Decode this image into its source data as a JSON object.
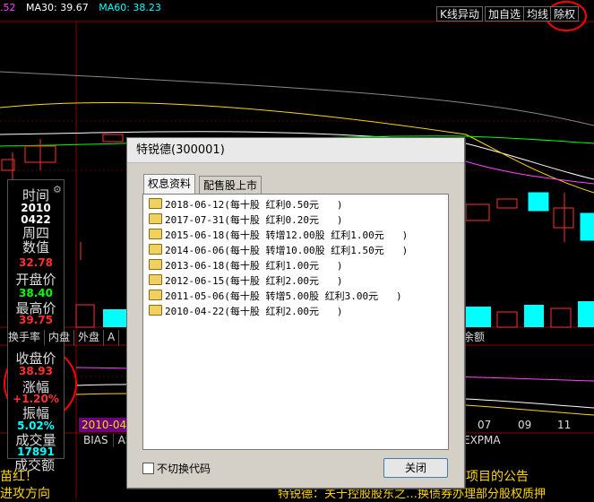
{
  "ma_bar": {
    "ma_first": ".52",
    "ma30": "MA30: 39.67",
    "ma60": "MA60: 38.23"
  },
  "toolbar": {
    "kline": "K线异动",
    "add_fav": "加自选",
    "avg": "均线",
    "exright": "除权"
  },
  "info_panel": {
    "time_label": "时间",
    "year": "2010",
    "date": "0422",
    "weekday": "周四",
    "value_label": "数值",
    "value": "32.78",
    "open_label": "开盘价",
    "open": "38.40",
    "high_label": "最高价",
    "high": "39.75",
    "close_label": "收盘价",
    "close": "38.93",
    "change_label": "涨幅",
    "change": "+1.20%",
    "amp_label": "振幅",
    "amp": "5.02%",
    "vol_label": "成交量",
    "vol": "17891",
    "amt_label": "成交额"
  },
  "bottom_tabs": [
    "换手率",
    "内盘",
    "外盘",
    "A"
  ],
  "right_tab": "余额",
  "indicators": [
    "BIAS",
    "AS"
  ],
  "indicator_expma": "EXPMA",
  "date_label": "2010-04-",
  "month_labels": [
    "07",
    "09",
    "11"
  ],
  "news": {
    "left1": "苗红！",
    "left2": "进攻方向",
    "right1": "项目的公告",
    "bottom_mid": "特锐德：关于控股股东之…换债券办理部分股权质押"
  },
  "dialog": {
    "title": "特锐德(300001)",
    "tabs": [
      "权息资料",
      "配售股上市"
    ],
    "rows": [
      "2018-06-12(每十股 红利0.50元   )",
      "2017-07-31(每十股 红利0.20元   )",
      "2015-06-18(每十股 转增12.00股 红利1.00元   )",
      "2014-06-06(每十股 转增10.00股 红利1.50元   )",
      "2013-06-18(每十股 红利1.00元   )",
      "2012-06-15(每十股 红利2.00元   )",
      "2011-05-06(每十股 转增5.00股 红利3.00元   )",
      "2010-04-22(每十股 红利2.00元   )"
    ],
    "checkbox": "不切换代码",
    "close_button": "关闭"
  },
  "colors": {
    "ma30": "#ffffff",
    "ma60": "#00ffff",
    "up": "#ff3030",
    "down": "#00ffff",
    "annotation": "#ff0000",
    "news": "#ffd700"
  }
}
